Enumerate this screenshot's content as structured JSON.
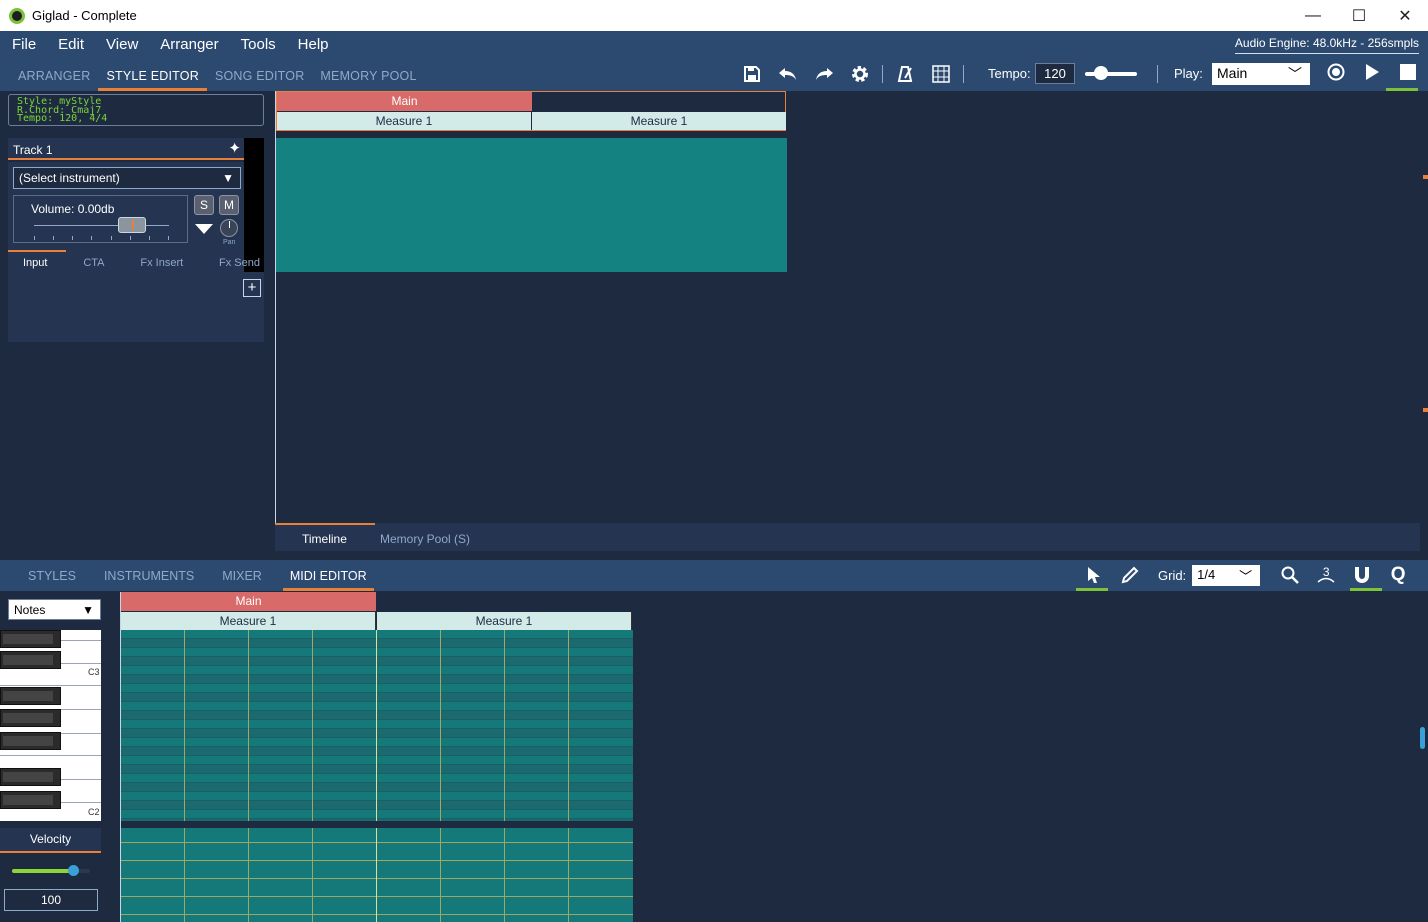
{
  "window": {
    "title": "Giglad - Complete",
    "minimize": "—",
    "maximize": "☐",
    "close": "✕"
  },
  "menu": {
    "items": [
      "File",
      "Edit",
      "View",
      "Arranger",
      "Tools",
      "Help"
    ],
    "engine_info": "Audio Engine: 48.0kHz - 256smpls"
  },
  "toolbar": {
    "tabs": [
      "ARRANGER",
      "STYLE EDITOR",
      "SONG EDITOR",
      "MEMORY POOL"
    ],
    "active_tab": "STYLE EDITOR",
    "tempo_label": "Tempo:",
    "tempo_value": "120",
    "tempo_slider_fraction": 0.3,
    "play_label": "Play:",
    "play_value": "Main",
    "icons": [
      "save-icon",
      "undo-icon",
      "redo-icon",
      "settings-icon",
      "metronome-icon",
      "grid-icon",
      "record-icon",
      "play-icon",
      "stop-icon"
    ]
  },
  "style_info": {
    "line1": "Style: myStyle",
    "line2": "R.Chord: Cmaj7",
    "line3": "Tempo: 120, 4/4"
  },
  "track": {
    "name": "Track 1",
    "instrument": "(Select instrument)",
    "volume": "Volume: 0.00db",
    "solo": "S",
    "mute": "M",
    "pan_label": "Pan",
    "subtabs": [
      "Input",
      "CTA",
      "Fx Insert",
      "Fx Send"
    ],
    "active_subtab": "Input"
  },
  "arranger": {
    "section": "Main",
    "measures": [
      "Measure 1",
      "Measure 1"
    ]
  },
  "upper_bottom_tabs": [
    "Timeline",
    "Memory Pool (S)"
  ],
  "lower": {
    "tabs": [
      "STYLES",
      "INSTRUMENTS",
      "MIXER",
      "MIDI EDITOR"
    ],
    "active_tab": "MIDI EDITOR",
    "grid_label": "Grid:",
    "grid_value": "1/4",
    "triplet_label": "3",
    "quantize_label": "Q"
  },
  "midi": {
    "view_select": "Notes",
    "section": "Main",
    "measures": [
      "Measure 1",
      "Measure 1"
    ],
    "key_labels": [
      "C3",
      "C2"
    ],
    "velocity_tab": "Velocity",
    "velocity_value": "100",
    "velocity_fraction": 0.78
  },
  "colors": {
    "accent": "#e8803a",
    "panel": "#2c4a70",
    "background": "#1e2a40",
    "section": "#d96a6a",
    "pattern": "#158282",
    "active_green": "#7cc23a"
  }
}
